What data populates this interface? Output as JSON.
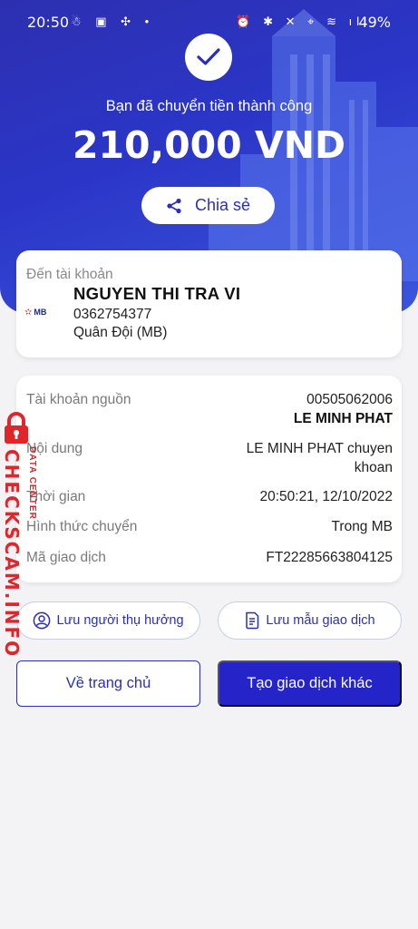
{
  "status_bar": {
    "time": "20:50",
    "left_icons": "☃ ▣ ✣ •",
    "right_icons": "⏰ ✱ ✕ ⌖ ≋ ıll",
    "battery": "49%"
  },
  "hero": {
    "success_message": "Bạn đã chuyển tiền thành công",
    "amount": "210,000 VND",
    "share_label": "Chia sẻ"
  },
  "destination": {
    "label": "Đến tài khoản",
    "bank_logo_text": "MB",
    "name": "NGUYEN THI TRA VI",
    "account_number": "0362754377",
    "bank_name": "Quân Đội (MB)"
  },
  "details": {
    "source_label": "Tài khoản nguồn",
    "source_account": "00505062006",
    "source_name": "LE MINH PHAT",
    "content_label": "Nội dung",
    "content_line1": "LE MINH PHAT chuyen",
    "content_line2": "khoan",
    "time_label": "Thời gian",
    "time_value": "20:50:21, 12/10/2022",
    "method_label": "Hình thức chuyển",
    "method_value": "Trong MB",
    "txn_label": "Mã giao dịch",
    "txn_value": "FT22285663804125"
  },
  "actions": {
    "save_recipient": "Lưu người thụ hưởng",
    "save_template": "Lưu mẫu giao dịch",
    "home": "Về trang chủ",
    "new_transaction": "Tạo giao dịch khác"
  },
  "watermark": {
    "site": "CHECKSCAM.INFO",
    "subtitle": "DATA CENTER"
  },
  "colors": {
    "primary": "#2a2fb8",
    "button_fill": "#2424c8",
    "watermark": "#e0262b"
  }
}
